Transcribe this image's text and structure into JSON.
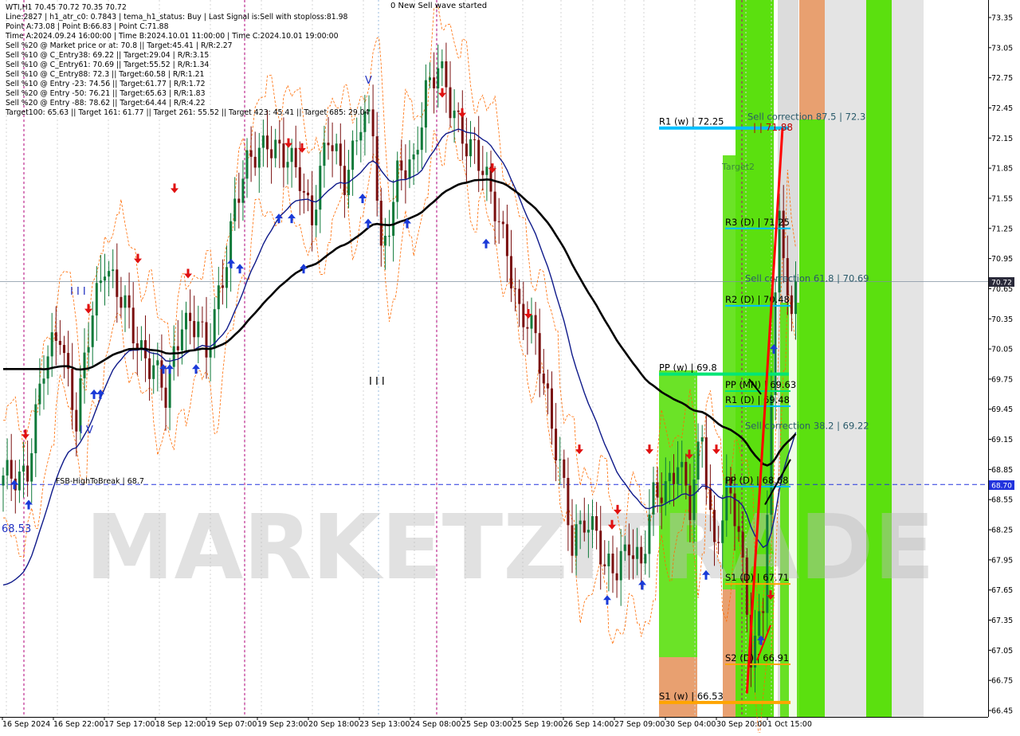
{
  "info_lines": [
    "WTI,H1  70.45 70.72 70.35 70.72",
    "Line:2827 | h1_atr_c0: 0.7843 | tema_h1_status: Buy | Last Signal is:Sell with stoploss:81.98",
    "Point A:73.08 | Point B:66.83 | Point C:71.88",
    "Time A:2024.09.24 16:00:00 | Time B:2024.10.01 11:00:00 | Time C:2024.10.01 19:00:00",
    "Sell %20 @ Market price or at: 70.8 || Target:45.41 | R/R:2.27",
    "Sell %10 @ C_Entry38: 69.22 || Target:29.04 | R/R:3.15",
    "Sell %10 @ C_Entry61: 70.69 || Target:55.52 | R/R:1.34",
    "Sell %10 @ C_Entry88: 72.3 || Target:60.58 | R/R:1.21",
    "Sell %10 @ Entry -23: 74.56 || Target:61.77 | R/R:1.72",
    "Sell %20 @ Entry -50: 76.21 || Target:65.63 | R/R:1.83",
    "Sell %20 @ Entry -88: 78.62 || Target:64.44 | R/R:4.22",
    "Target100: 65.63 || Target 161: 61.77 || Target 261: 55.52 || Target 423: 45.41 || Target 685: 29.04"
  ],
  "header_annotation": "0 New Sell wave started",
  "watermark": "MARKETZITRADE",
  "current_price_label": "70.72",
  "fsb_price_label": "68.70",
  "fsb_line_label": "FSB-HighToBreak | 68.7",
  "low_marker_label": "68.53",
  "wave_labels": {
    "v_top": "V",
    "iii": "I I I",
    "iv": "I V",
    "iii_low": "I I I"
  },
  "target2_label": "Target2",
  "point_c_label": "| | 71.88",
  "colors": {
    "up_candle": "#0f7a3a",
    "down_candle": "#7a0f0f",
    "blue_ma": "#0f1a8a",
    "black_ma": "#000000",
    "orange_band": "#ff6a00",
    "bright_green": "#5be00f",
    "salmon": "#e8a070",
    "pivot_cyan": "#00bfff",
    "pivot_green": "#00e676",
    "support_orange": "#ffa500",
    "red_line": "#ff0000",
    "current_price_bg": "#2a2a3a",
    "fsb_bg": "#2233dd"
  },
  "chart_data": {
    "type": "candlestick",
    "symbol": "WTI",
    "timeframe": "H1",
    "ylim": [
      66.45,
      73.4
    ],
    "price_ticks": [
      "73.35",
      "73.05",
      "72.75",
      "72.45",
      "72.15",
      "71.85",
      "71.55",
      "71.25",
      "70.95",
      "70.65",
      "70.35",
      "70.05",
      "69.75",
      "69.45",
      "69.15",
      "68.85",
      "68.55",
      "68.25",
      "67.95",
      "67.65",
      "67.35",
      "67.05",
      "66.75",
      "66.45"
    ],
    "time_labels": [
      "16 Sep 2024",
      "16 Sep 22:00",
      "17 Sep 17:00",
      "18 Sep 12:00",
      "19 Sep 07:00",
      "19 Sep 23:00",
      "20 Sep 18:00",
      "23 Sep 13:00",
      "24 Sep 08:00",
      "25 Sep 03:00",
      "25 Sep 19:00",
      "26 Sep 14:00",
      "27 Sep 09:00",
      "30 Sep 04:00",
      "30 Sep 20:00",
      "1 Oct 15:00"
    ],
    "close_anchors": [
      [
        0,
        68.7
      ],
      [
        6,
        68.9
      ],
      [
        10,
        69.8
      ],
      [
        14,
        70.3
      ],
      [
        18,
        69.3
      ],
      [
        22,
        70.4
      ],
      [
        25,
        71.0
      ],
      [
        28,
        70.6
      ],
      [
        32,
        70.2
      ],
      [
        37,
        69.9
      ],
      [
        40,
        69.5
      ],
      [
        44,
        70.4
      ],
      [
        48,
        70.3
      ],
      [
        50,
        69.9
      ],
      [
        53,
        70.6
      ],
      [
        57,
        71.5
      ],
      [
        61,
        71.9
      ],
      [
        65,
        72.2
      ],
      [
        69,
        71.9
      ],
      [
        73,
        71.8
      ],
      [
        76,
        71.4
      ],
      [
        80,
        72.1
      ],
      [
        84,
        71.8
      ],
      [
        88,
        72.3
      ],
      [
        91,
        72.2
      ],
      [
        93,
        71.0
      ],
      [
        97,
        71.8
      ],
      [
        101,
        71.8
      ],
      [
        104,
        72.7
      ],
      [
        107,
        72.9
      ],
      [
        110,
        72.4
      ],
      [
        113,
        72.2
      ],
      [
        116,
        72.1
      ],
      [
        120,
        71.5
      ],
      [
        124,
        71.1
      ],
      [
        127,
        70.4
      ],
      [
        131,
        70.1
      ],
      [
        134,
        69.6
      ],
      [
        137,
        68.9
      ],
      [
        140,
        68.0
      ],
      [
        143,
        68.4
      ],
      [
        146,
        68.3
      ],
      [
        148,
        67.8
      ],
      [
        151,
        67.8
      ],
      [
        154,
        68.2
      ],
      [
        157,
        67.9
      ],
      [
        160,
        68.5
      ],
      [
        163,
        68.7
      ],
      [
        166,
        69.0
      ],
      [
        169,
        68.4
      ],
      [
        172,
        69.2
      ],
      [
        175,
        68.1
      ],
      [
        178,
        68.6
      ],
      [
        181,
        68.2
      ],
      [
        184,
        67.1
      ],
      [
        187,
        67.5
      ],
      [
        189,
        69.4
      ],
      [
        191,
        71.5
      ],
      [
        193,
        70.5
      ],
      [
        195,
        70.45
      ]
    ],
    "key_points": {
      "A": {
        "time": "2024.09.24 16:00:00",
        "price": 73.08
      },
      "B": {
        "time": "2024.10.01 11:00:00",
        "price": 66.83
      },
      "C": {
        "time": "2024.10.01 19:00:00",
        "price": 71.88
      }
    },
    "levels": [
      {
        "label": "R1 (w) | 72.25",
        "price": 72.25,
        "color": "#00bfff"
      },
      {
        "label": "Sell correction 87.5 | 72.3",
        "price": 72.3,
        "color": "#00bfff"
      },
      {
        "label": "R3 (D) | 71.25",
        "price": 71.25,
        "color": "#00bfff"
      },
      {
        "label": "Sell correction 61.8 | 70.69",
        "price": 70.69,
        "color": "#00bfff"
      },
      {
        "label": "R2 (D) | 70.48",
        "price": 70.48,
        "color": "#00bfff"
      },
      {
        "label": "PP (w) | 69.8",
        "price": 69.8,
        "color": "#00e676"
      },
      {
        "label": "PP (MN) | 69.63",
        "price": 69.63,
        "color": "#00e676"
      },
      {
        "label": "R1 (D) | 69.48",
        "price": 69.48,
        "color": "#00bfff"
      },
      {
        "label": "Sell correction 38.2 | 69.22",
        "price": 69.22,
        "color": "#00bfff"
      },
      {
        "label": "PP (D) | 68.68",
        "price": 68.68,
        "color": "#00bfff"
      },
      {
        "label": "S1 (D) | 67.71",
        "price": 67.71,
        "color": "#ffa500"
      },
      {
        "label": "S2 (D) | 66.91",
        "price": 66.91,
        "color": "#ffa500"
      },
      {
        "label": "S1 (w) | 66.53",
        "price": 66.53,
        "color": "#ffa500"
      }
    ],
    "current_price": 70.72,
    "fsb_level": 68.7
  }
}
